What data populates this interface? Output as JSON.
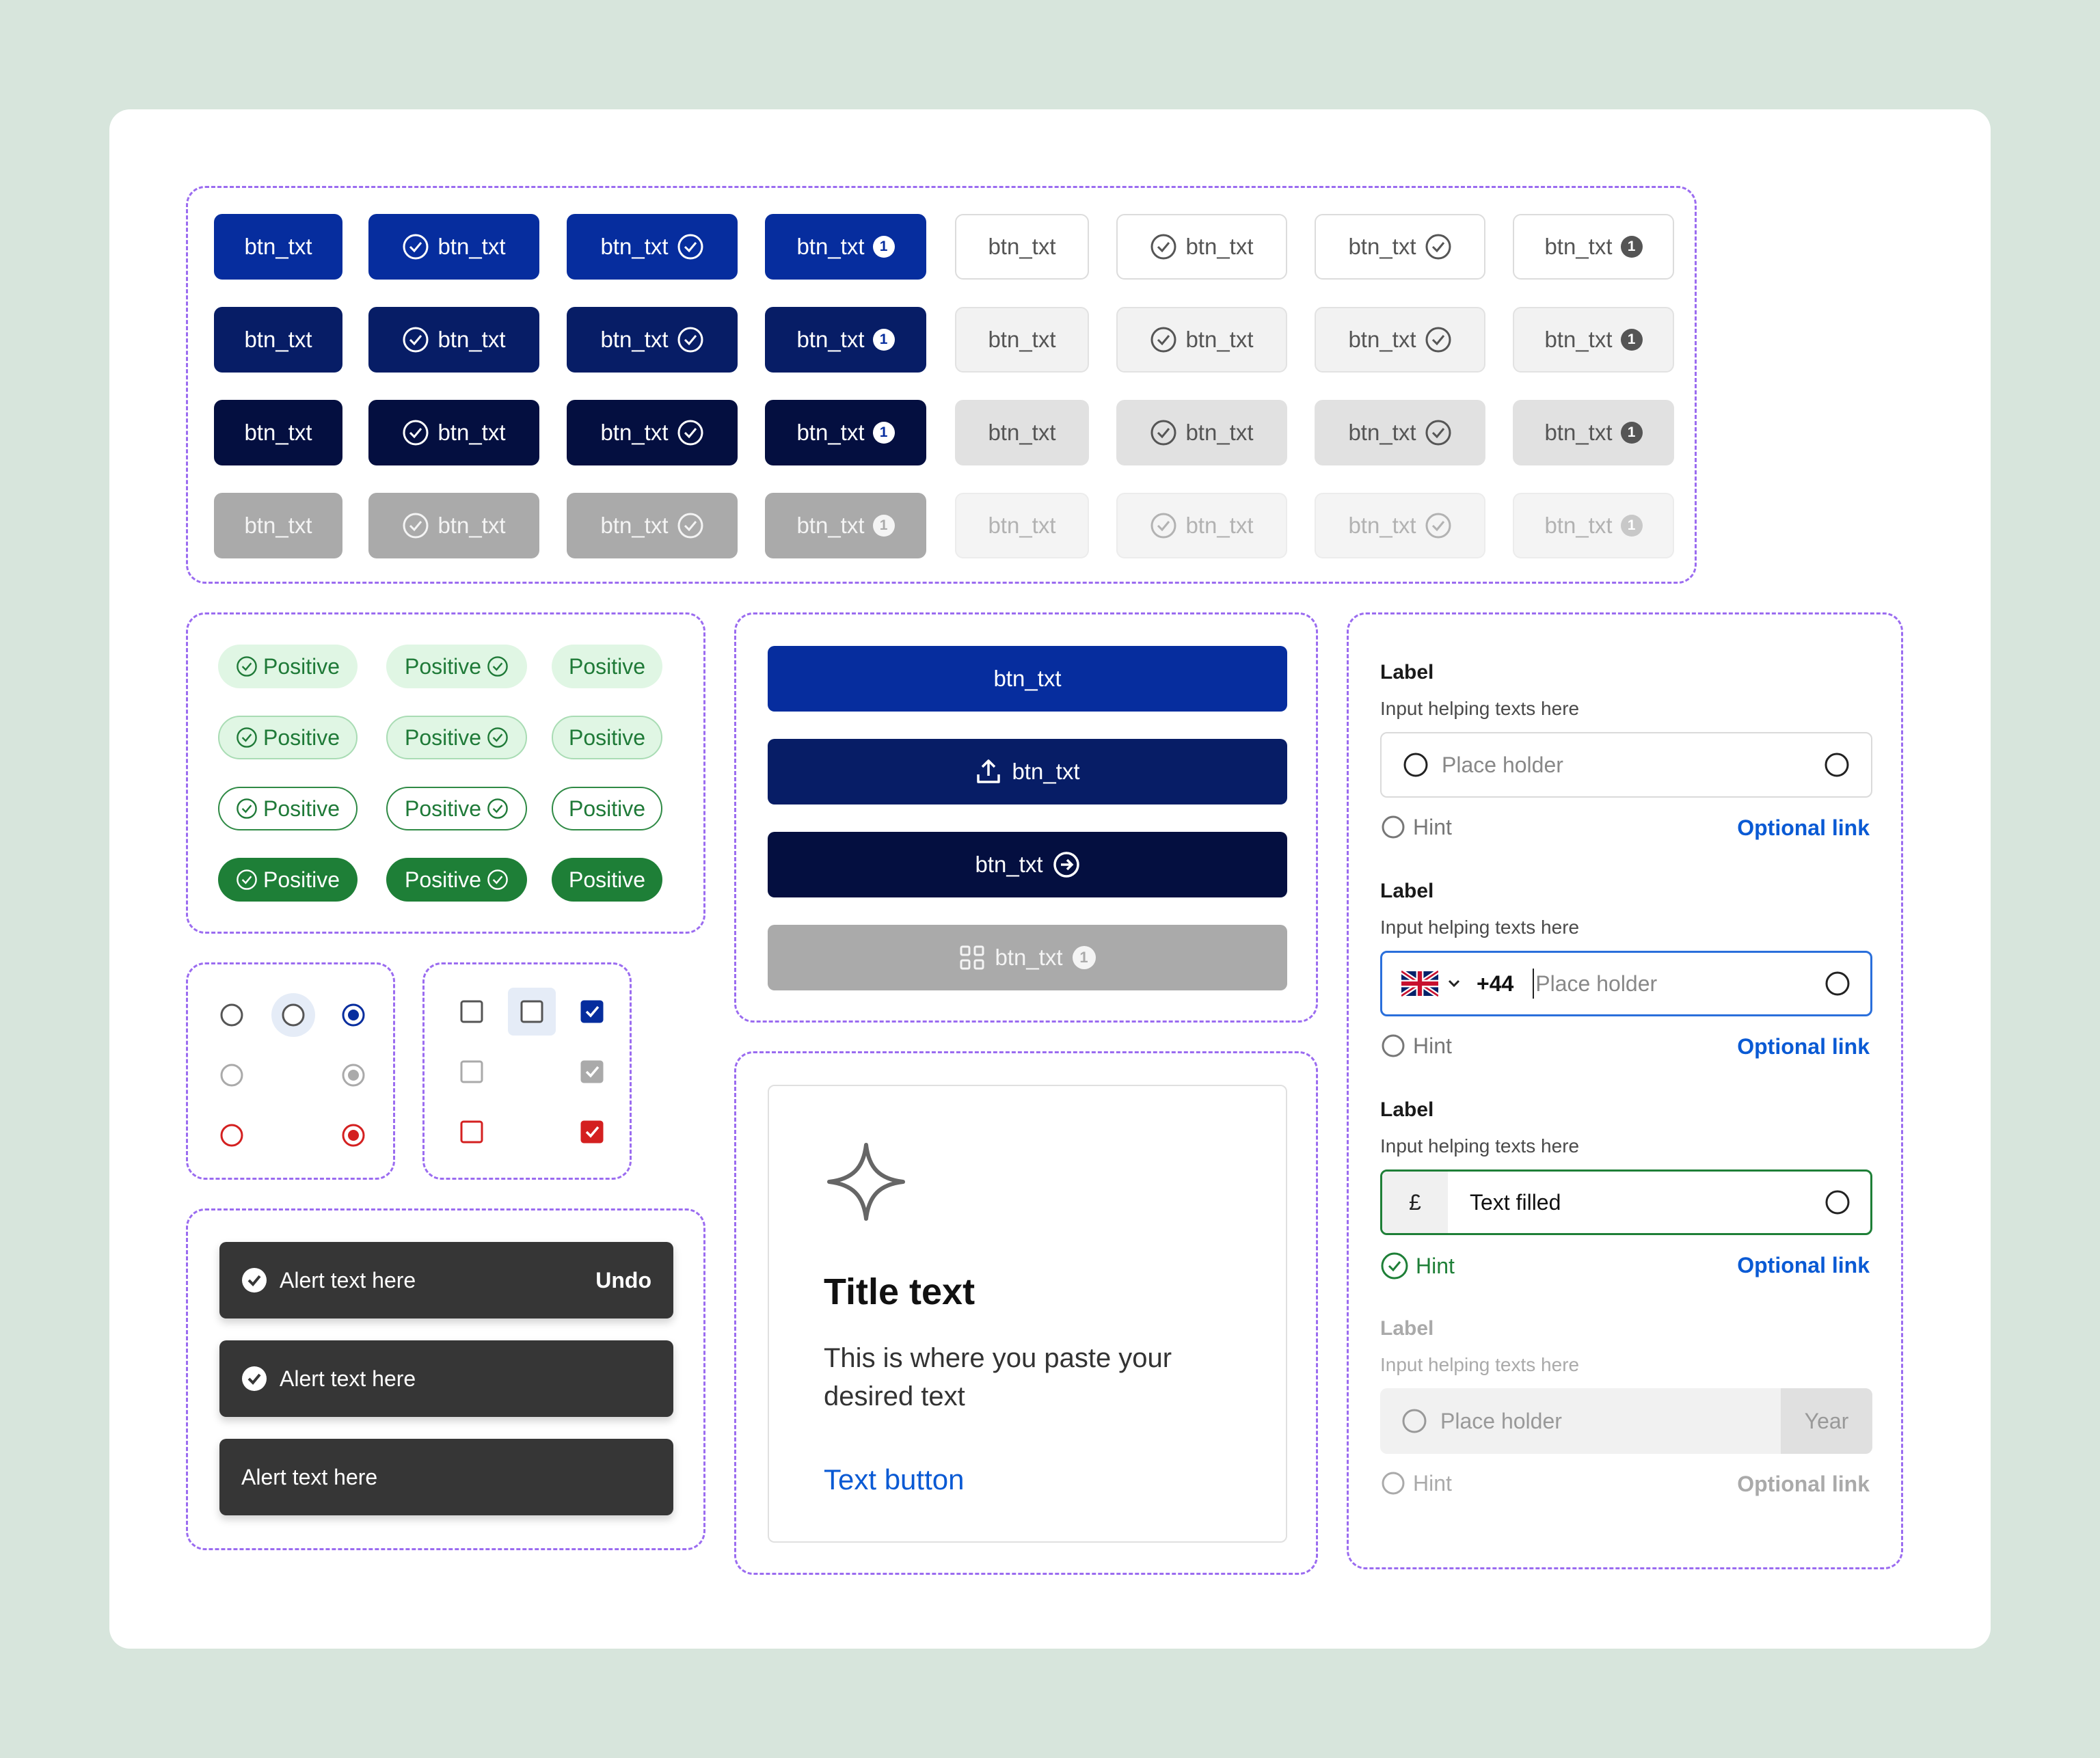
{
  "button_grid": {
    "label": "btn_txt",
    "badge": "1"
  },
  "tags": {
    "label": "Positive"
  },
  "wide_buttons": {
    "label": "btn_txt",
    "badge": "1"
  },
  "alerts": [
    {
      "text": "Alert text here",
      "action": "Undo"
    },
    {
      "text": "Alert text here"
    },
    {
      "text": "Alert text here"
    }
  ],
  "info_card": {
    "icon": "sparkle-icon",
    "title": "Title text",
    "body": "This is where you paste your desired text",
    "action": "Text button"
  },
  "forms": [
    {
      "label": "Label",
      "help": "Input helping texts here",
      "placeholder": "Place holder",
      "hint": "Hint",
      "link": "Optional link"
    },
    {
      "label": "Label",
      "help": "Input helping texts here",
      "placeholder": "Place holder",
      "prefix": "+44",
      "hint": "Hint",
      "link": "Optional link"
    },
    {
      "label": "Label",
      "help": "Input helping texts here",
      "value": "Text filled",
      "currency": "£",
      "hint": "Hint",
      "link": "Optional link"
    },
    {
      "label": "Label",
      "help": "Input helping texts here",
      "placeholder": "Place holder",
      "suffix": "Year",
      "hint": "Hint",
      "link": "Optional link"
    }
  ],
  "colors": {
    "primary": "#062d9e",
    "primary_dark": "#071d66",
    "primary_darker": "#040f40",
    "positive": "#1e7f37",
    "link": "#0a5ad4",
    "error": "#d42020",
    "focus": "#2a6fdb",
    "background": "#d7e5dc"
  }
}
